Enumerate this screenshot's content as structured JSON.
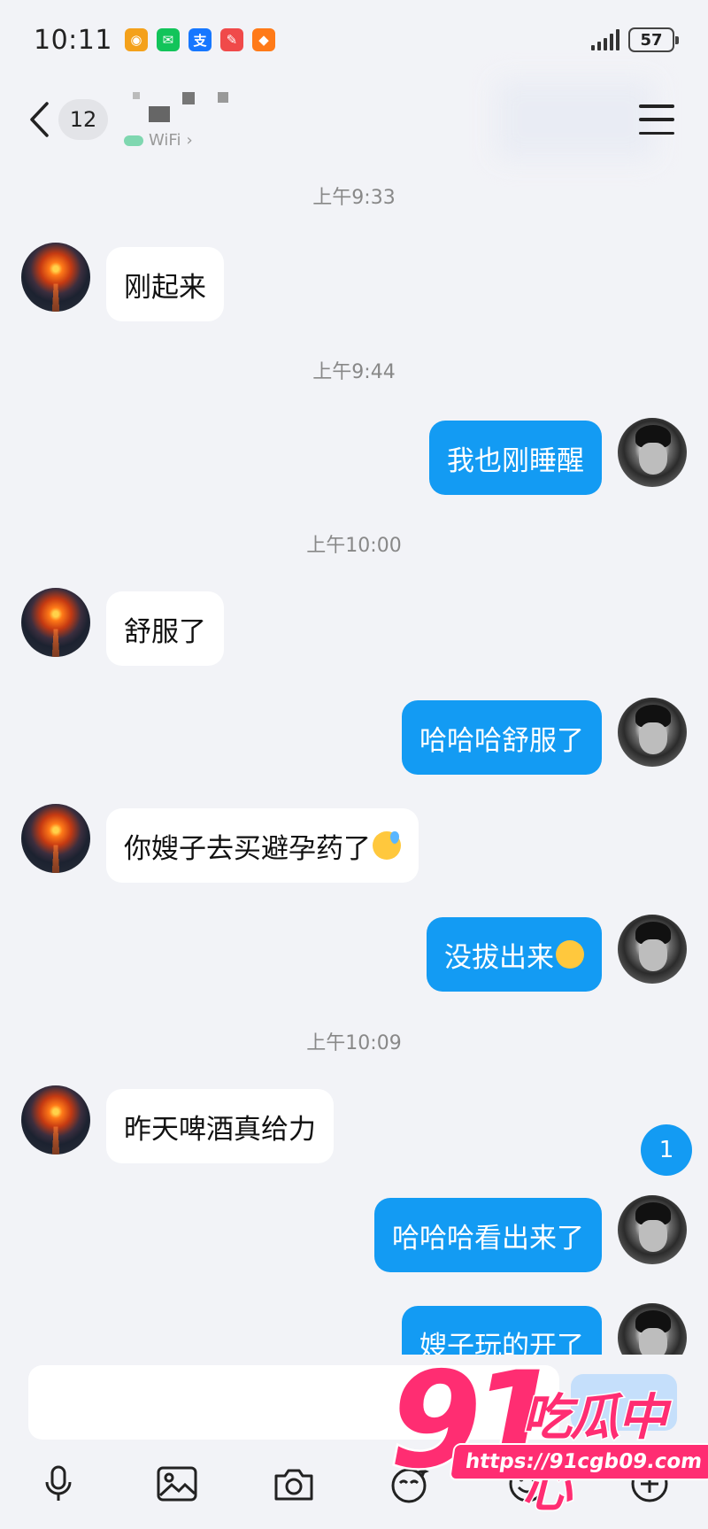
{
  "status_bar": {
    "time": "10:11",
    "battery": "57",
    "app_icons": [
      {
        "name": "weibo-icon",
        "color": "#f4a11b",
        "glyph": "◉"
      },
      {
        "name": "wechat-icon",
        "color": "#12c45a",
        "glyph": "✉"
      },
      {
        "name": "alipay-icon",
        "color": "#1677ff",
        "glyph": "支"
      },
      {
        "name": "notes-icon",
        "color": "#f04a4a",
        "glyph": "✎"
      },
      {
        "name": "taobao-icon",
        "color": "#ff7a18",
        "glyph": "◆"
      }
    ]
  },
  "header": {
    "unread_count": "12",
    "subtitle": "WiFi"
  },
  "messages": [
    {
      "timestamp": "上午9:33"
    },
    {
      "from": "other",
      "text": "刚起来"
    },
    {
      "timestamp": "上午9:44"
    },
    {
      "from": "me",
      "text": "我也刚睡醒"
    },
    {
      "timestamp": "上午10:00"
    },
    {
      "from": "other",
      "text": "舒服了"
    },
    {
      "from": "me",
      "text": "哈哈哈舒服了"
    },
    {
      "from": "other",
      "text": "你嫂子去买避孕药了",
      "emoji": "sweat-emoji"
    },
    {
      "from": "me",
      "text": "没拔出来",
      "emoji": "smile-emoji"
    },
    {
      "timestamp": "上午10:09"
    },
    {
      "from": "other",
      "text": "昨天啤酒真给力"
    },
    {
      "from": "me",
      "text": "哈哈哈看出来了"
    },
    {
      "from": "me",
      "text": "嫂子玩的开了"
    }
  ],
  "new_message_badge": "1",
  "watermark": {
    "number": "91",
    "text": "吃瓜中心",
    "url": "https://91cgb09.com"
  },
  "toolbar_icons": [
    "microphone-icon",
    "image-icon",
    "camera-icon",
    "sticker-icon",
    "emoji-icon",
    "plus-icon"
  ],
  "colors": {
    "outgoing_bubble": "#139bf3",
    "incoming_bubble": "#ffffff",
    "background": "#f2f3f7",
    "watermark": "#ff2d72"
  }
}
